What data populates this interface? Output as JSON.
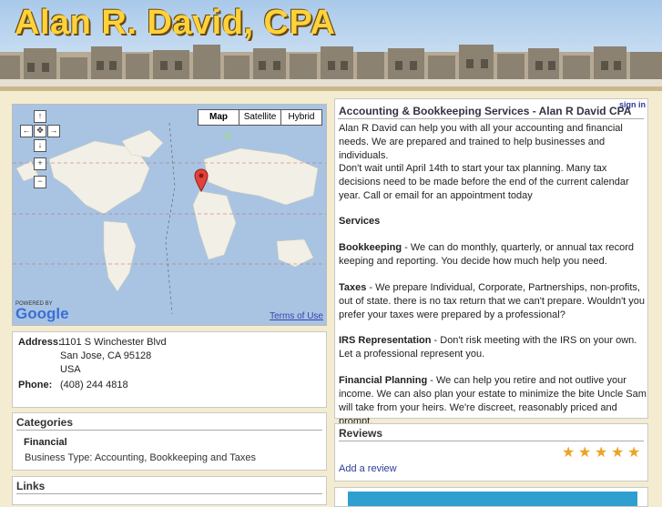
{
  "header": {
    "title": "Alan R. David, CPA"
  },
  "map": {
    "types": [
      "Map",
      "Satellite",
      "Hybrid"
    ],
    "selected_type": "Map",
    "powered_by": "POWERED BY",
    "brand": "Google",
    "terms_link": "Terms of Use"
  },
  "contact": {
    "address_label": "Address:",
    "address_line1": "1101 S Winchester Blvd",
    "address_line2": "San Jose, CA 95128",
    "address_line3": "USA",
    "phone_label": "Phone:",
    "phone": "(408) 244 4818"
  },
  "categories": {
    "heading": "Categories",
    "category": "Financial",
    "business_type": "Business Type: Accounting, Bookkeeping and Taxes"
  },
  "links": {
    "heading": "Links"
  },
  "business": {
    "title": "Accounting & Bookkeeping Services - Alan R David CPA",
    "sign_in": "sign in",
    "intro": "Alan R David can help you with all your accounting and financial needs. We are prepared and trained to help businesses and individuals.",
    "tax_planning": "Don't wait until April 14th to start your tax planning. Many tax decisions need to be made before the end of the current calendar year. Call or email for an appointment today",
    "services_heading": "Services",
    "bookkeeping_label": "Bookkeeping",
    "bookkeeping_text": " - We can do monthly, quarterly, or annual tax record keeping and reporting. You decide how much help you need.",
    "taxes_label": "Taxes",
    "taxes_text": " - We prepare Individual, Corporate, Partnerships, non-profits, out of state. there is no tax return that we can't prepare. Wouldn't you prefer your taxes were prepared by a professional?",
    "irs_label": "IRS Representation",
    "irs_text": " - Don't risk meeting with the IRS on your own. Let a professional represent you.",
    "fp_label": "Financial Planning",
    "fp_text": " - We can help you retire and not outlive your income. We can also plan your estate to minimize the bite Uncle Sam will take from your heirs. We're discreet, reasonably priced and prompt."
  },
  "reviews": {
    "heading": "Reviews",
    "rating": 5,
    "rating_max": 5,
    "add_review": "Add a review",
    "star_color": "#f0a224"
  }
}
